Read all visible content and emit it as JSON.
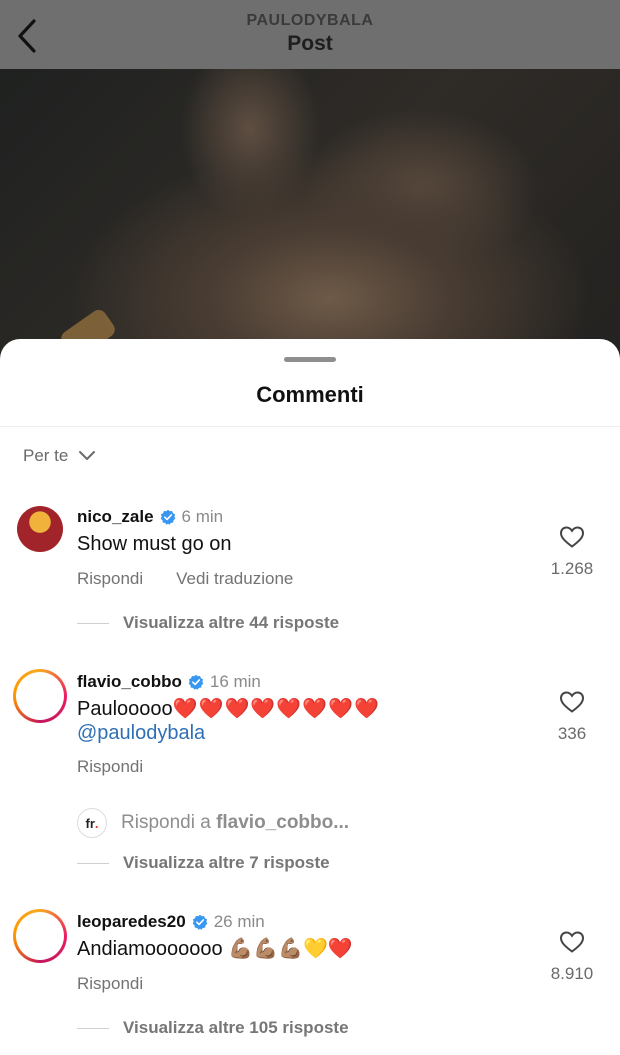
{
  "header": {
    "owner": "PAULODYBALA",
    "title": "Post"
  },
  "sheet": {
    "title": "Commenti",
    "sort_label": "Per te"
  },
  "comments": [
    {
      "username": "nico_zale",
      "time": "6 min",
      "text": "Show must go on",
      "actions": [
        "Rispondi",
        "Vedi traduzione"
      ],
      "likes": "1.268",
      "replies_label": "Visualizza altre 44 risposte"
    },
    {
      "username": "flavio_cobbo",
      "time": "16 min",
      "text": "Paulooooo",
      "emoji": "❤️❤️❤️❤️❤️❤️❤️❤️",
      "mention": "@paulodybala",
      "actions": [
        "Rispondi"
      ],
      "likes": "336",
      "reply_to_prefix": "Rispondi a",
      "reply_to_user": "flavio_cobbo...",
      "replies_label": "Visualizza altre 7 risposte"
    },
    {
      "username": "leoparedes20",
      "time": "26 min",
      "text": "Andiamooooooo",
      "emoji": "💪🏽💪🏽💪🏽💛❤️",
      "actions": [
        "Rispondi"
      ],
      "likes": "8.910",
      "replies_label": "Visualizza altre 105 risposte"
    }
  ],
  "icons": {
    "back": "chevron-left-icon",
    "sort": "chevron-down-icon",
    "verified": "verified-badge-icon",
    "like": "heart-outline-icon"
  },
  "colors": {
    "verified": "#3897f0",
    "mention": "#2f6fb5",
    "heart": "#e0262d"
  }
}
